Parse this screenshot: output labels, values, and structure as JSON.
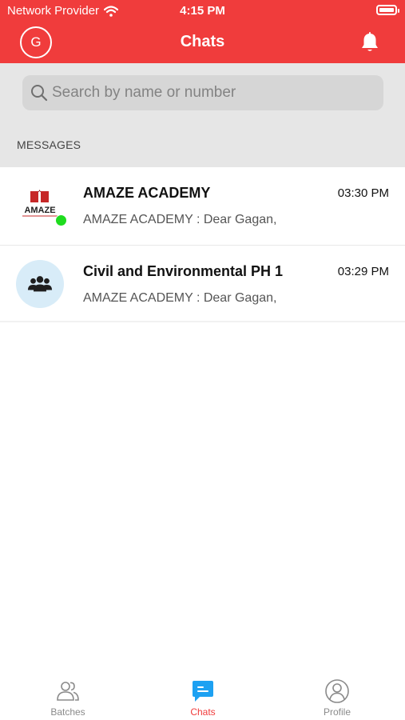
{
  "status_bar": {
    "carrier": "Network Provider",
    "time": "4:15 PM"
  },
  "header": {
    "avatar_initial": "G",
    "title": "Chats"
  },
  "search": {
    "placeholder": "Search by name or number"
  },
  "messages_section": {
    "label": "MESSAGES"
  },
  "chats": [
    {
      "name": "AMAZE ACADEMY",
      "time": "03:30 PM",
      "preview": "AMAZE ACADEMY : Dear Gagan,",
      "avatar_text": "AMAZE",
      "online": true
    },
    {
      "name": "Civil and Environmental PH 1",
      "time": "03:29 PM",
      "preview": "AMAZE ACADEMY : Dear Gagan,",
      "avatar_icon": "group-icon",
      "online": false
    }
  ],
  "tabs": [
    {
      "label": "Batches",
      "icon": "batches-icon",
      "active": false
    },
    {
      "label": "Chats",
      "icon": "chat-bubble-icon",
      "active": true
    },
    {
      "label": "Profile",
      "icon": "profile-icon",
      "active": false
    }
  ],
  "colors": {
    "primary_red": "#f03c3c",
    "chats_tab_blue": "#1da1f2",
    "online_green": "#1edc1e",
    "search_bg": "#e6e6e6"
  }
}
